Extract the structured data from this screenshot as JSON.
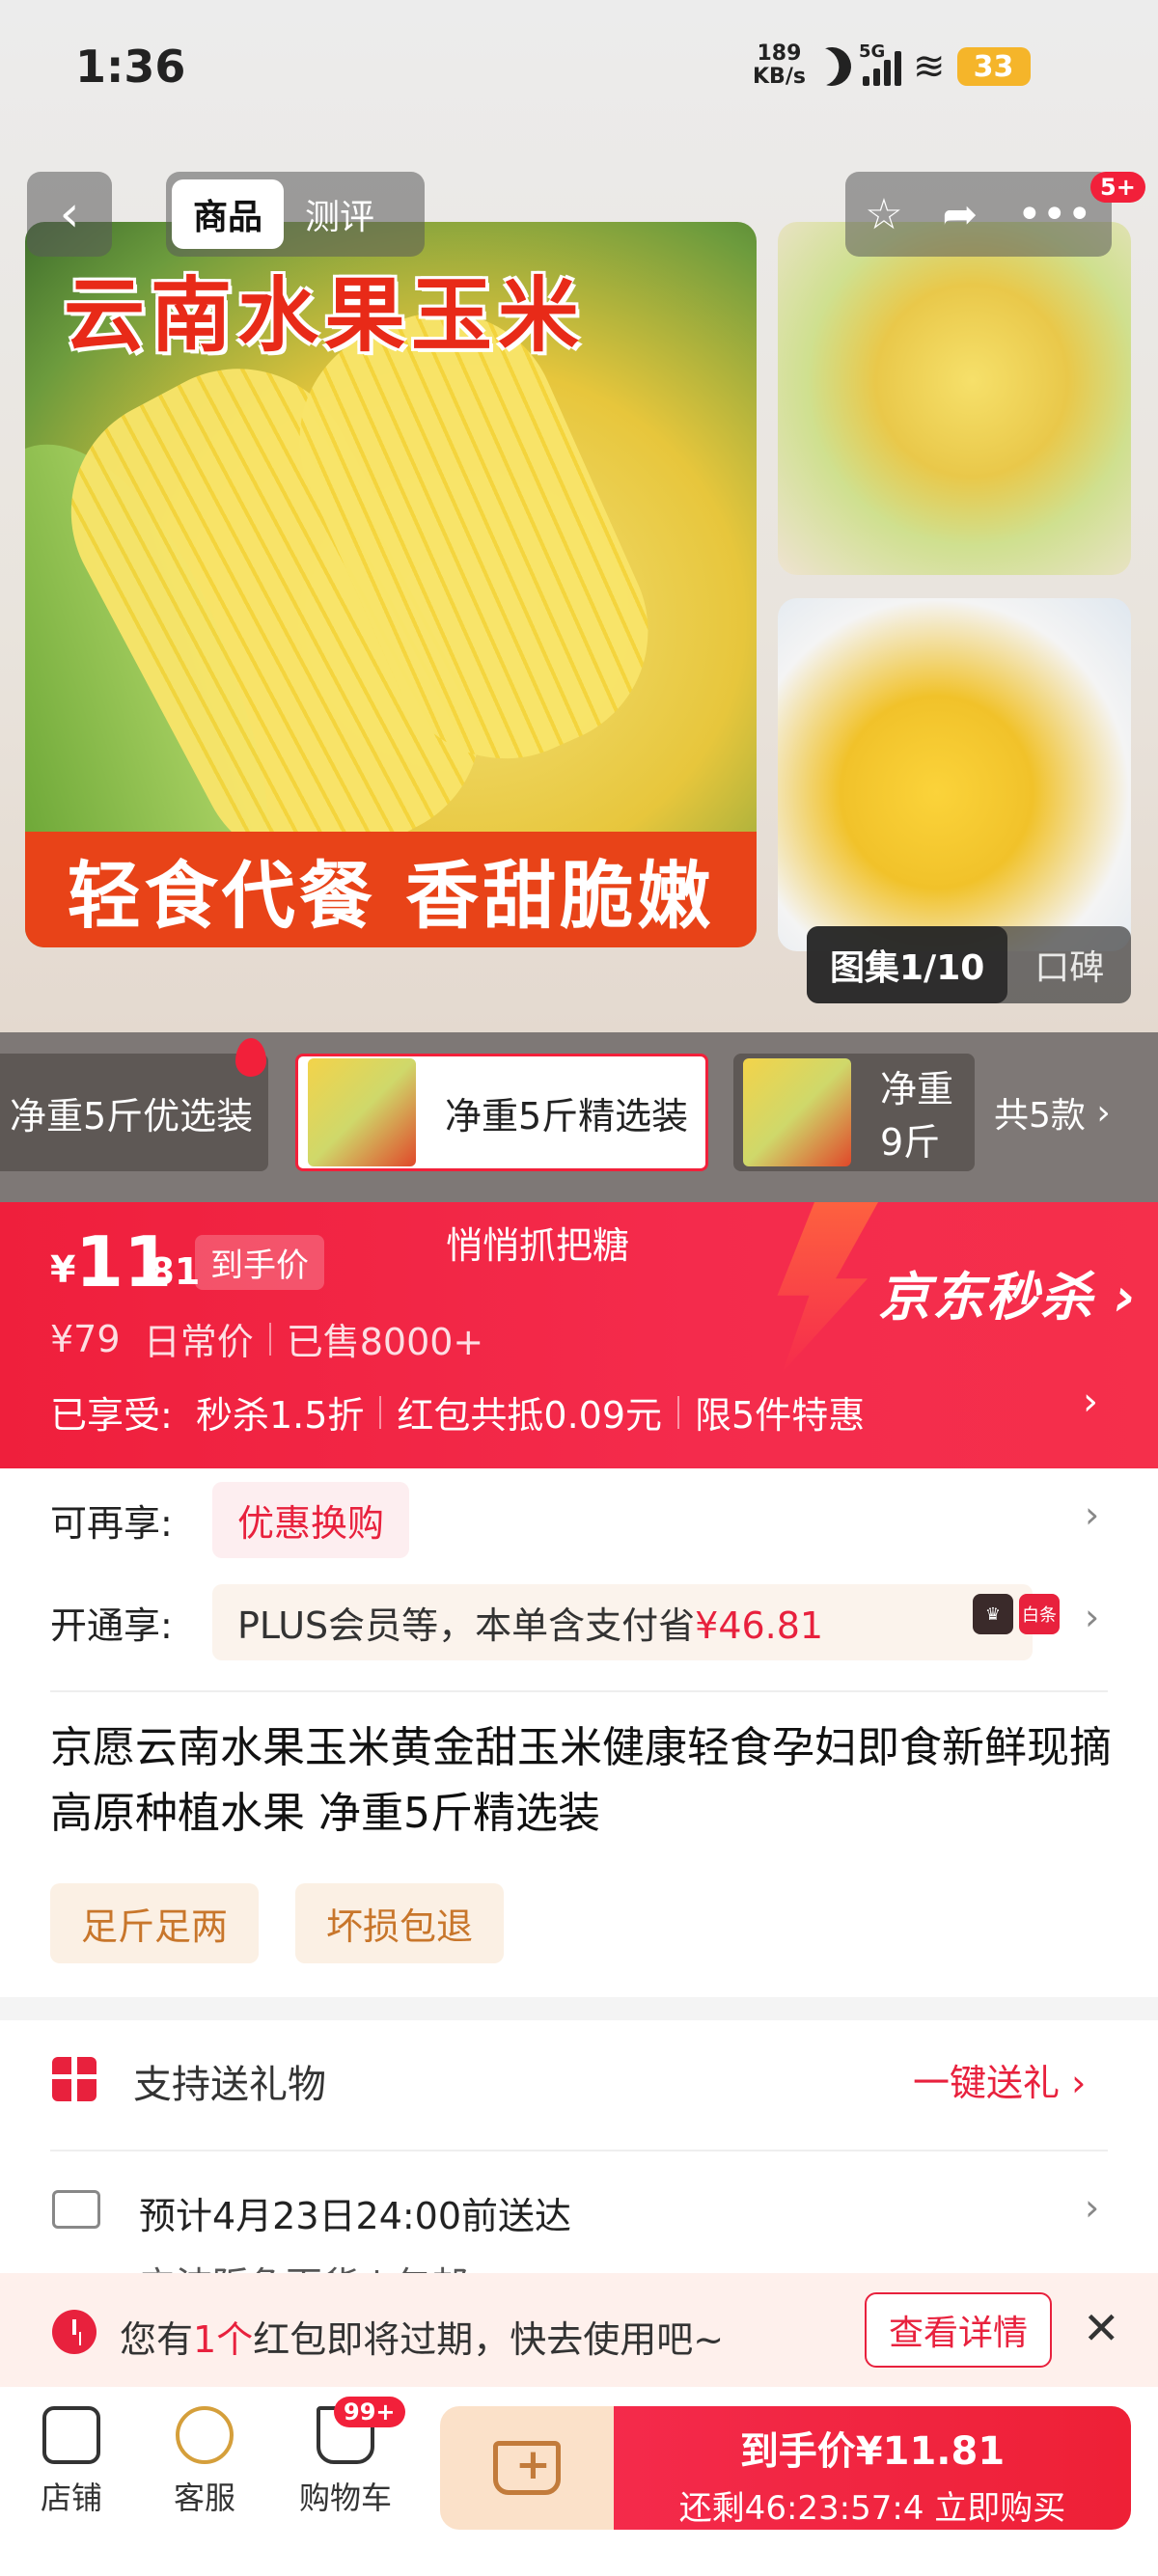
{
  "status": {
    "time": "1:36",
    "speed_value": "189",
    "speed_unit": "KB/s",
    "network": "5G",
    "battery": "33"
  },
  "nav": {
    "tabs": [
      {
        "label": "商品",
        "active": true
      },
      {
        "label": "测评",
        "active": false
      }
    ],
    "badge": "5+"
  },
  "gallery": {
    "main_title": "云南水果玉米",
    "main_banner": "轻食代餐 香甜脆嫩",
    "count": "图集1/10",
    "review_tab": "口碑"
  },
  "variants": {
    "items": [
      {
        "label": "净重5斤优选装"
      },
      {
        "label": "净重5斤精选装",
        "selected": true
      },
      {
        "label": "净重9斤"
      }
    ],
    "total": "共5款"
  },
  "price": {
    "currency": "¥",
    "integer": "11",
    "decimal": ".81",
    "tag": "到手价",
    "slogan": "悄悄抓把糖",
    "seckill_brand": "京东秒杀",
    "original": "¥79",
    "original_label": "日常价",
    "sold": "已售8000+",
    "promo_prefix": "已享受:",
    "promo_1": "秒杀1.5折",
    "promo_2": "红包共抵0.09元",
    "promo_3": "限5件特惠"
  },
  "offers": {
    "row1_label": "可再享:",
    "row1_chip": "优惠换购",
    "row2_label": "开通享:",
    "row2_chip": "PLUS会员等，本单含支付省",
    "row2_amount": "¥46.81",
    "row2_icon_right": "白条"
  },
  "product": {
    "title": "京愿云南水果玉米黄金甜玉米健康轻食孕妇即食新鲜现摘高原种植水果 净重5斤精选装",
    "tags": [
      "足斤足两",
      "坏损包退"
    ]
  },
  "service": {
    "gift_text": "支持送礼物",
    "gift_link": "一键送礼",
    "delivery_text": "预计4月23日24:00前送达",
    "delivery_sub": "宁波阪急百货 | 包邮"
  },
  "notice": {
    "prefix": "您有",
    "count": "1个",
    "suffix": "红包即将过期，快去使用吧~",
    "button": "查看详情"
  },
  "bottom": {
    "store": "店铺",
    "service": "客服",
    "cart": "购物车",
    "cart_badge": "99+",
    "buy_price_label": "到手价¥11.81",
    "buy_countdown": "还剩46:23:57:4  立即购买"
  },
  "colors": {
    "accent_red": "#f2203a",
    "price_bar": "#ef1f3c",
    "tag_bg": "#fbf0e4",
    "tag_text": "#c8762b"
  }
}
